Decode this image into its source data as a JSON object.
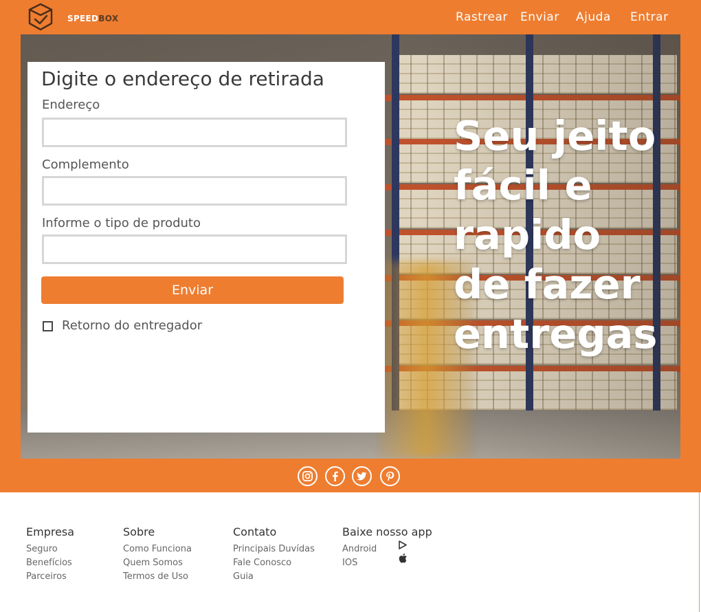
{
  "brand": {
    "part1": "SPEED",
    "part2": "BOX",
    "logo_icon": "box-check-icon"
  },
  "nav": {
    "rastrear": "Rastrear",
    "enviar": "Enviar",
    "ajuda": "Ajuda",
    "entrar": "Entrar"
  },
  "colors": {
    "accent": "#ee7d30",
    "text": "#333333",
    "input_border": "#d6d6d6"
  },
  "hero": {
    "headline": "Seu jeito\nfácil e\nrapido\nde fazer\nentregas"
  },
  "form": {
    "title": "Digite o endereço de retirada",
    "endereco_label": "Endereço",
    "endereco_value": "",
    "complemento_label": "Complemento",
    "complemento_value": "",
    "produto_label": "Informe o tipo de produto",
    "produto_value": "",
    "submit_label": "Enviar",
    "checkbox_label": "Retorno do entregador",
    "checkbox_checked": false
  },
  "social": [
    "instagram-icon",
    "facebook-icon",
    "twitter-icon",
    "pinterest-icon"
  ],
  "footer": {
    "empresa": {
      "title": "Empresa",
      "links": [
        "Seguro",
        "Benefícios",
        "Parceiros"
      ]
    },
    "sobre": {
      "title": "Sobre",
      "links": [
        "Como Funciona",
        "Quem Somos",
        "Termos de Uso"
      ]
    },
    "contato": {
      "title": "Contato",
      "links": [
        "Principais Duvídas",
        "Fale Conosco",
        "Guia"
      ]
    },
    "app": {
      "title": "Baixe nosso app",
      "links": [
        "Android",
        "IOS"
      ],
      "icons": [
        "play-store-icon",
        "apple-icon"
      ]
    }
  }
}
